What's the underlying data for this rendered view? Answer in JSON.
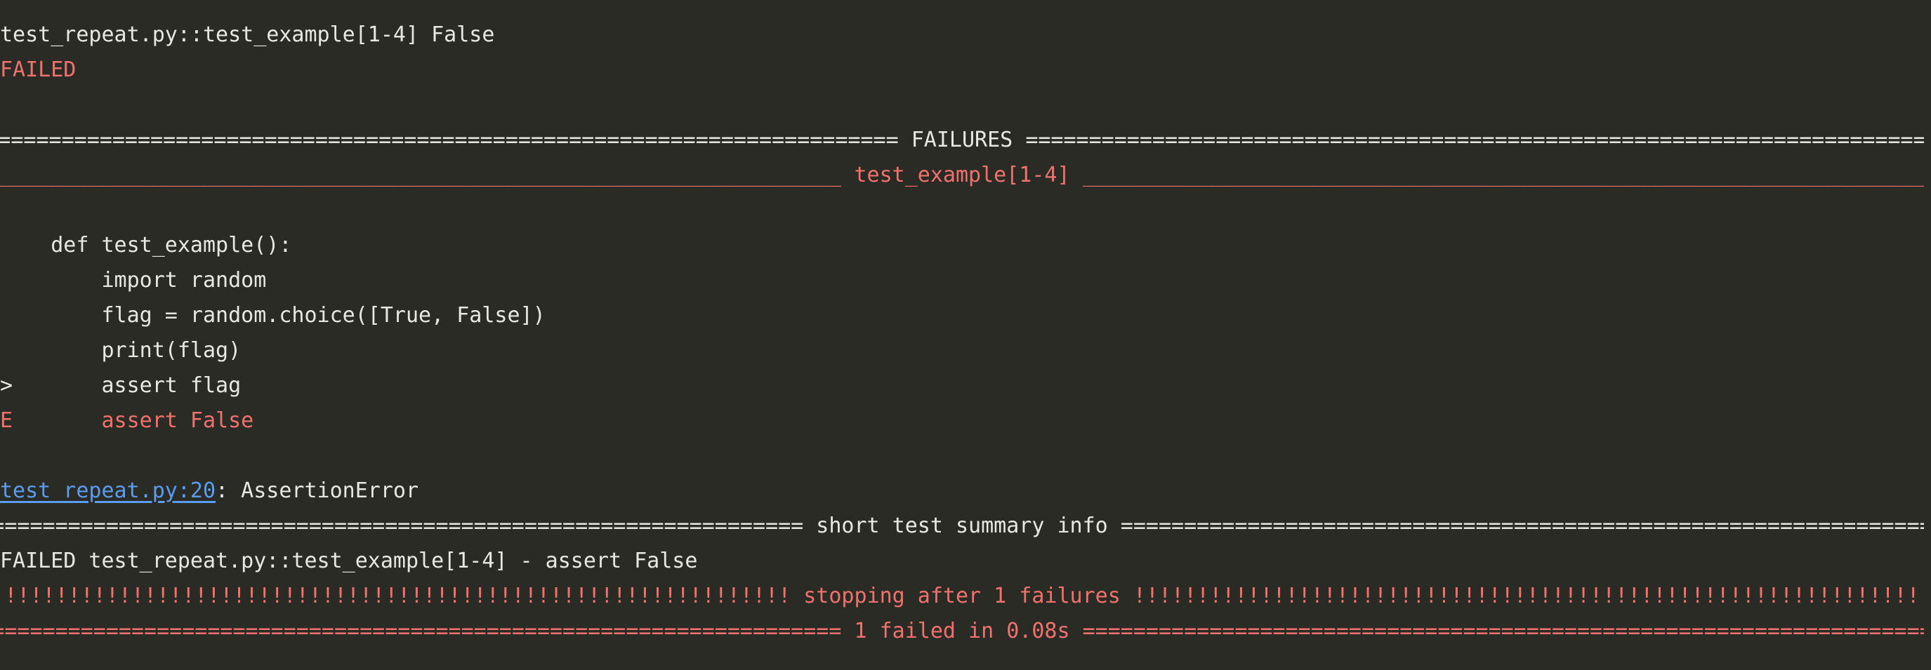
{
  "colors": {
    "background": "#2b2b26",
    "text": "#e8e8e3",
    "error": "#f0716d",
    "link": "#5a9cf2"
  },
  "lines": {
    "header": "test_repeat.py::test_example[1-4] False",
    "status": "FAILED",
    "failures_title": " FAILURES ",
    "test_title": " test_example[1-4] ",
    "code_def": "    def test_example():",
    "code_import": "        import random",
    "code_flag": "        flag = random.choice([True, False])",
    "code_print": "        print(flag)",
    "code_assert_marker": ">",
    "code_assert": "       assert flag",
    "code_error_marker": "E",
    "code_error": "       assert False",
    "traceback_link": "test_repeat.py:20",
    "traceback_rest": ": AssertionError",
    "summary_title": " short test summary info ",
    "summary_line": "FAILED test_repeat.py::test_example[1-4] - assert False",
    "stopping_title": " stopping after 1 failures ",
    "result_title": " 1 failed in 0.08s "
  },
  "fill_chars": {
    "equals": "=",
    "underscore": "_",
    "bang": "!"
  }
}
